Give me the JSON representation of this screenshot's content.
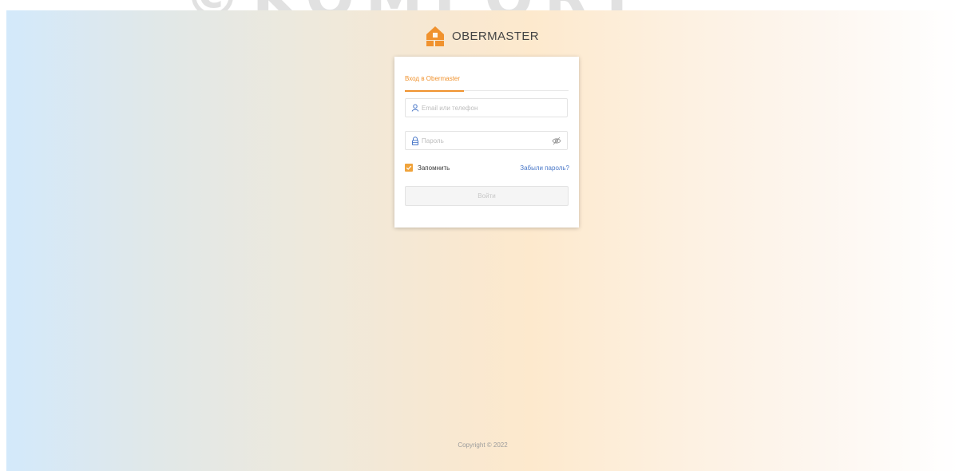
{
  "watermark": {
    "text": "©KOMFORT"
  },
  "brand": {
    "logo_icon": "house-logo-icon",
    "name": "OBERMASTER",
    "accent_color": "#f0922e"
  },
  "login_card": {
    "tab_label": "Вход в Obermaster",
    "login_field": {
      "placeholder": "Email или телефон",
      "value": "",
      "icon": "user-icon"
    },
    "password_field": {
      "placeholder": "Пароль",
      "value": "",
      "icon": "lock-icon",
      "toggle_icon": "eye-slash-icon"
    },
    "remember": {
      "label": "Запомнить",
      "checked": true
    },
    "forgot_link": "Забыли пароль?",
    "submit_label": "Войти"
  },
  "footer": {
    "copyright": "Copyright © 2022"
  }
}
